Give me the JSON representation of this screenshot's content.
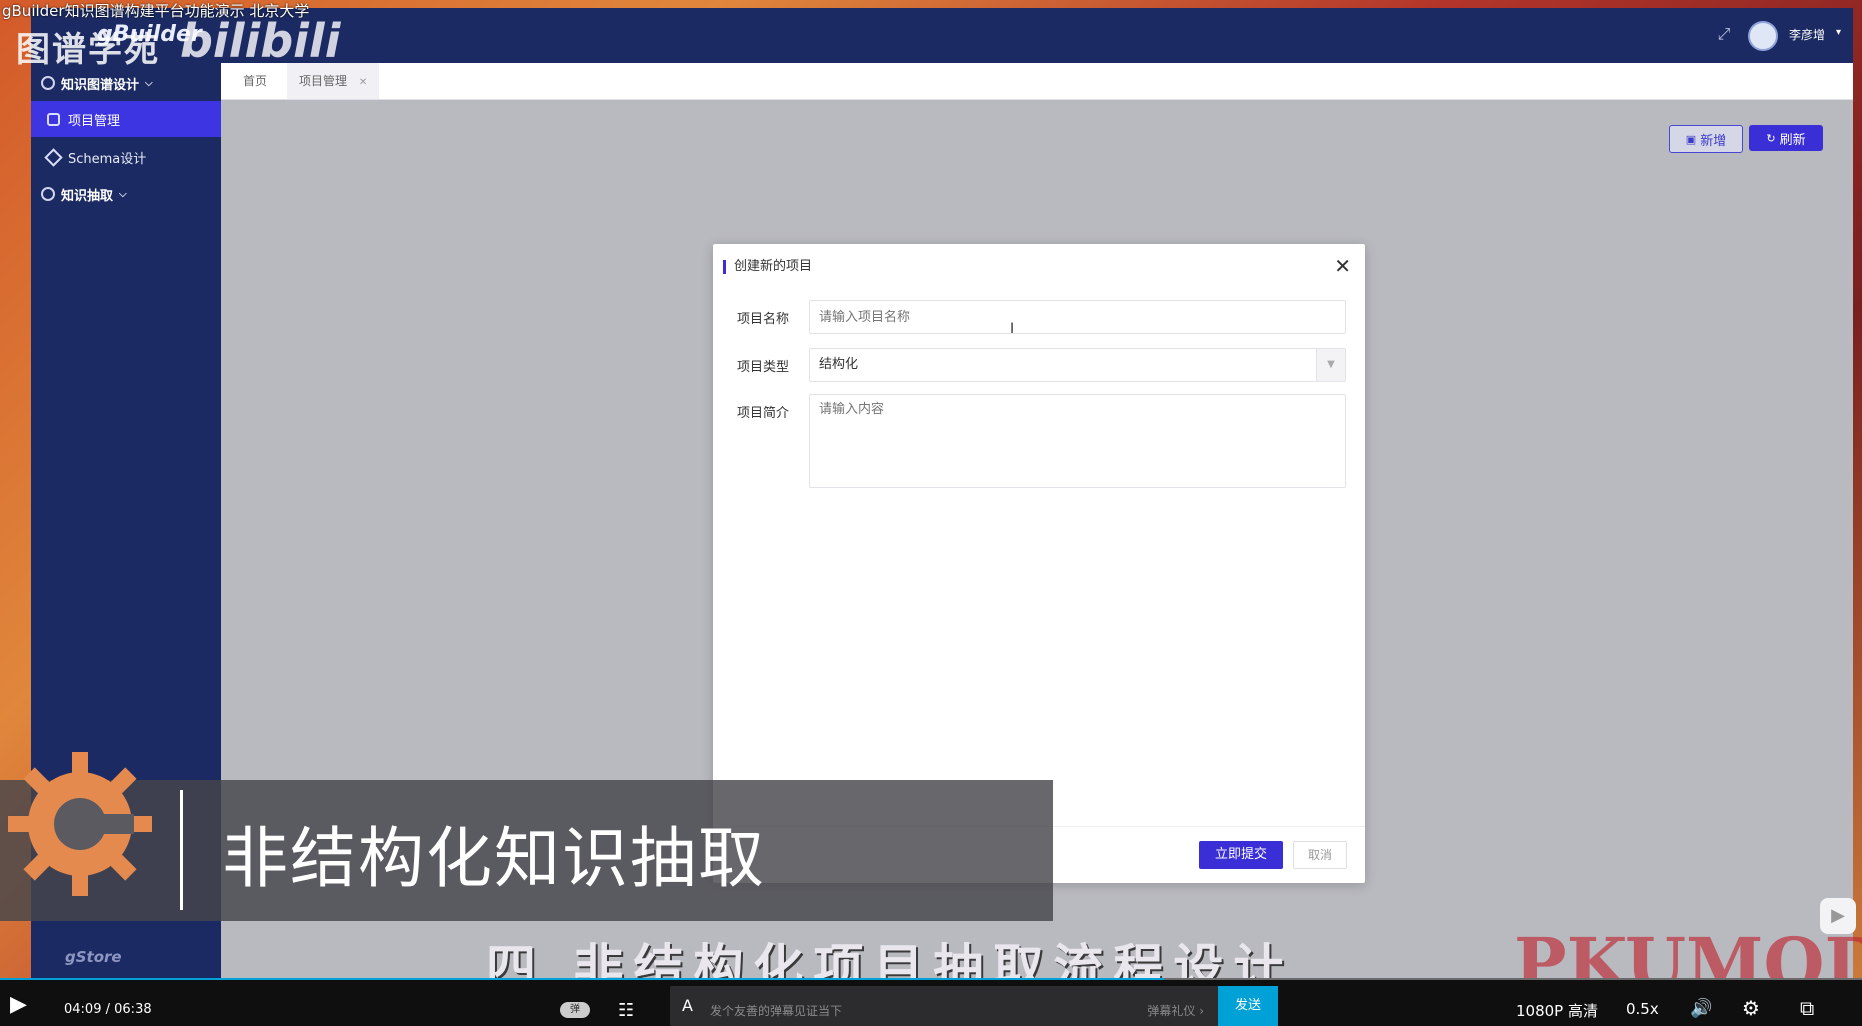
{
  "video_title": "gBuilder知识图谱构建平台功能演示 北京大学",
  "watermarks": {
    "site": "图谱学苑",
    "bili": "bilibili",
    "app_logo": "gBuilder",
    "brand": "PKUMOD",
    "powered": "gStore"
  },
  "header": {
    "user_name": "李彦增"
  },
  "sidebar": {
    "group_design": "知识图谱设计",
    "items": [
      {
        "label": "项目管理",
        "active": true
      },
      {
        "label": "Schema设计",
        "active": false
      }
    ],
    "group_extract": "知识抽取"
  },
  "tabs": [
    {
      "label": "首页"
    },
    {
      "label": "项目管理"
    }
  ],
  "toolbar": {
    "new_label": "新增",
    "refresh_label": "刷新"
  },
  "modal": {
    "title": "创建新的项目",
    "fields": {
      "name": {
        "label": "项目名称",
        "placeholder": "请输入项目名称",
        "value": ""
      },
      "type": {
        "label": "项目类型",
        "value": "结构化"
      },
      "intro": {
        "label": "项目简介",
        "placeholder": "请输入内容"
      }
    },
    "submit_label": "立即提交",
    "cancel_label": "取消"
  },
  "overlay": {
    "banner": "非结构化知识抽取",
    "subtitle": "四  非结构化项目抽取流程设计"
  },
  "player": {
    "current_time": "04:09",
    "separator": "/",
    "duration": "06:38",
    "progress_fraction": 0.625,
    "danmaku_toggle": "弹",
    "danmaku_placeholder": "发个友善的弹幕见证当下",
    "danmaku_gift": "弹幕礼仪 ›",
    "send_label": "发送",
    "quality": "1080P 高清",
    "speed": "0.5x"
  }
}
